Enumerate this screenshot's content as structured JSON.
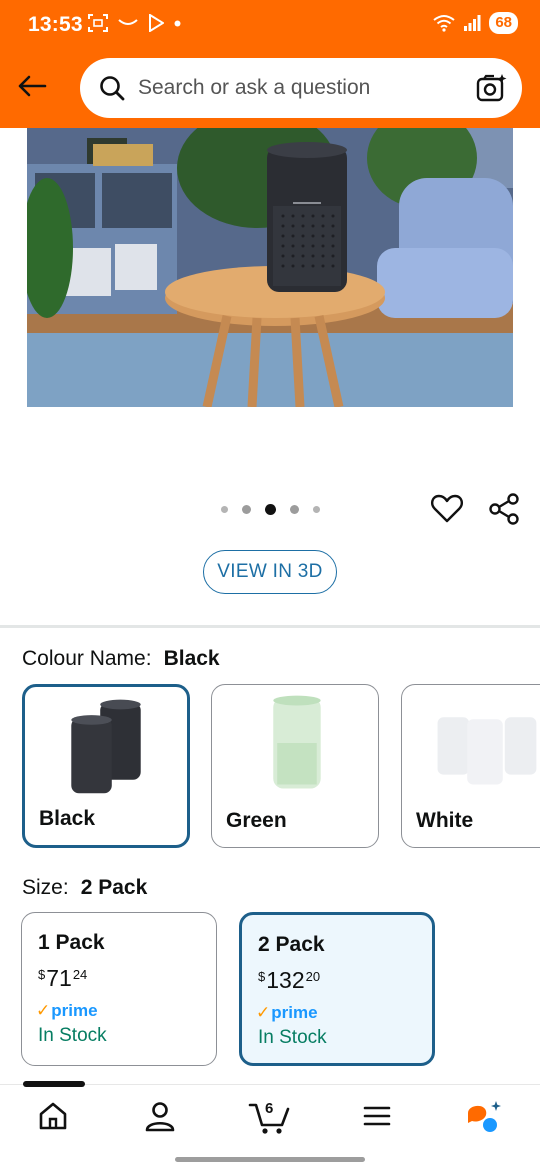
{
  "status_bar": {
    "time": "13:53",
    "battery": "68"
  },
  "header": {
    "search_placeholder": "Search or ask a question"
  },
  "gallery": {
    "dots": 5,
    "active_dot": 2,
    "view_3d_label": "VIEW IN 3D"
  },
  "colour": {
    "label": "Colour Name:",
    "selected": "Black",
    "options": [
      "Black",
      "Green",
      "White"
    ]
  },
  "size": {
    "label": "Size:",
    "selected": "2 Pack",
    "options": [
      {
        "name": "1 Pack",
        "currency": "$",
        "whole": "71",
        "fraction": "24",
        "prime": "prime",
        "stock": "In Stock"
      },
      {
        "name": "2 Pack",
        "currency": "$",
        "whole": "132",
        "fraction": "20",
        "prime": "prime",
        "stock": "In Stock"
      }
    ]
  },
  "nav": {
    "cart_count": "6"
  },
  "colors": {
    "header": "#ff6a00",
    "link": "#1d6fa5",
    "selected_border": "#1d5f8a",
    "in_stock": "#067d62",
    "prime": "#1a98ff"
  }
}
